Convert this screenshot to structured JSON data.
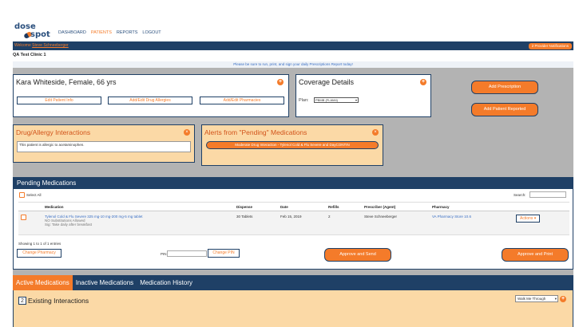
{
  "brand": {
    "line1": "dose",
    "line2": "spot"
  },
  "nav": {
    "items": [
      {
        "label": "DASHBOARD",
        "active": false
      },
      {
        "label": "PATIENTS",
        "active": true
      },
      {
        "label": "REPORTS",
        "active": false
      },
      {
        "label": "LOGOUT",
        "active": false
      }
    ]
  },
  "welcome": {
    "prefix": "Welcome ",
    "user": "Steve Schneeberger",
    "notifications": "2 Provider Notifications"
  },
  "clinic": "QA Test Clinic 1",
  "reminder": "Please be sure to run, print, and sign your daily Prescriptions Report today!",
  "patient": {
    "name": "Kara Whiteside, Female, 66 yrs",
    "edit_info": "Edit Patient Info",
    "edit_allergies": "Add/Edit Drug Allergies",
    "edit_pharmacies": "Add/Edit Pharmacies"
  },
  "coverage": {
    "title": "Coverage Details",
    "plan_label": "Plan:",
    "plan_value": "PBMB (FLAM4)"
  },
  "actions": {
    "add_prescription": "Add Prescription",
    "add_patient_reported": "Add Patient Reported"
  },
  "drug_interactions": {
    "title": "Drug/Allergy Interactions",
    "note": "This patient is allergic to acetaminophen."
  },
  "alerts": {
    "title": "Alerts from \"Pending\" Medications",
    "item": "Moderate Drug Interaction - Tylenol Cold & Flu Severe and DayCONTIN"
  },
  "pending": {
    "title": "Pending Medications",
    "select_all": "Select All",
    "search_label": "Search:",
    "columns": [
      "Medication",
      "Dispense",
      "Date",
      "Refills",
      "Prescriber (Agent)",
      "Pharmacy",
      ""
    ],
    "row": {
      "medication": "Tylenol Cold & Flu Severe 325 mg-10 mg-200 mg-5 mg tablet",
      "substitution": "NO Substitutions Allowed",
      "sig": "Sig: Take daily after breakfast",
      "dispense": "30 Tablets",
      "date": "Feb 15, 2019",
      "refills": "2",
      "prescriber": "Steve Schneeberger",
      "pharmacy": "VA Pharmacy Store 10.6",
      "actions": "Actions ▾"
    },
    "showing": "Showing 1 to 1 of 1 entries",
    "change_pharmacy": "Change Pharmacy",
    "pin_label": "PIN",
    "change_pin": "Change PIN",
    "approve_send": "Approve and Send",
    "approve_print": "Approve and Print"
  },
  "tabs": [
    {
      "label": "Active Medications",
      "active": true
    },
    {
      "label": "Inactive Medications",
      "active": false
    },
    {
      "label": "Medication History",
      "active": false
    }
  ],
  "existing": {
    "count": "2",
    "title": "Existing Interactions",
    "walkme": "Walk Me Through"
  },
  "colors": {
    "navy": "#1f4066",
    "orange": "#f47b2a",
    "yellow_panel": "#fbd9a6",
    "grey_bg": "#b3b3b3"
  },
  "icons": [
    "plus-icon",
    "close-icon",
    "checkbox-icon",
    "chevron-down-icon"
  ]
}
